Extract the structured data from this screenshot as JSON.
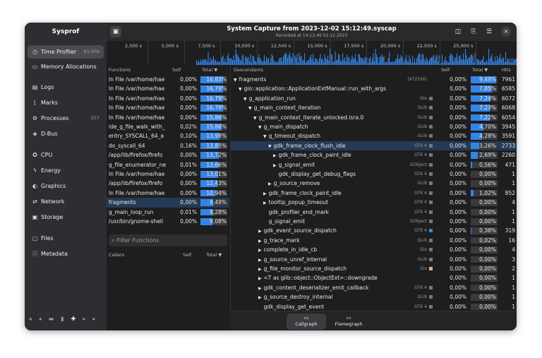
{
  "app": {
    "title": "Sysprof"
  },
  "header": {
    "title": "System Capture from 2023-12-02 15:12:49.syscap",
    "subtitle": "Recorded at 14:12:49 02.12.2023"
  },
  "sidebar": {
    "items": [
      {
        "label": "Time Profiler",
        "count": "83,908",
        "icon": "clock-icon"
      },
      {
        "label": "Memory Allocations",
        "count": "",
        "icon": "memory-icon"
      },
      {
        "label": "Logs",
        "count": "",
        "icon": "logs-icon"
      },
      {
        "label": "Marks",
        "count": "",
        "icon": "marks-icon"
      },
      {
        "label": "Processes",
        "count": "557",
        "icon": "processes-icon"
      },
      {
        "label": "D-Bus",
        "count": "",
        "icon": "dbus-icon"
      },
      {
        "label": "CPU",
        "count": "",
        "icon": "cpu-icon"
      },
      {
        "label": "Energy",
        "count": "",
        "icon": "energy-icon"
      },
      {
        "label": "Graphics",
        "count": "",
        "icon": "graphics-icon"
      },
      {
        "label": "Network",
        "count": "",
        "icon": "network-icon"
      },
      {
        "label": "Storage",
        "count": "",
        "icon": "storage-icon"
      },
      {
        "label": "Files",
        "count": "",
        "icon": "files-icon"
      },
      {
        "label": "Metadata",
        "count": "",
        "icon": "metadata-icon"
      }
    ]
  },
  "timeline": {
    "ticks": [
      "2,500 s",
      "5,000 s",
      "7,500 s",
      "10,000 s",
      "12,500 s",
      "15,000 s",
      "17,500 s",
      "20,000 s",
      "22,500 s",
      "25,000 s"
    ]
  },
  "functions": {
    "columns": {
      "name": "Functions",
      "self": "Self",
      "total": "Total"
    },
    "rows": [
      {
        "name": "In File /var/home/hae",
        "self": "0,00%",
        "total": "16,83%",
        "pct": 0.1683
      },
      {
        "name": "In File /var/home/hae",
        "self": "0,00%",
        "total": "16,79%",
        "pct": 0.1679
      },
      {
        "name": "In File /var/home/hae",
        "self": "0,00%",
        "total": "16,79%",
        "pct": 0.1679
      },
      {
        "name": "In File /var/home/hae",
        "self": "0,00%",
        "total": "16,79%",
        "pct": 0.1679
      },
      {
        "name": "In File /var/home/hae",
        "self": "0,00%",
        "total": "15,86%",
        "pct": 0.1586
      },
      {
        "name": "ide_g_file_walk_with_",
        "self": "0,02%",
        "total": "15,86%",
        "pct": 0.1586
      },
      {
        "name": "entry_SYSCALL_64_a",
        "self": "0,10%",
        "total": "13,98%",
        "pct": 0.1398
      },
      {
        "name": "do_syscall_64",
        "self": "0,16%",
        "total": "13,85%",
        "pct": 0.1385
      },
      {
        "name": "/app/lib/firefox/firefo",
        "self": "0,00%",
        "total": "13,72%",
        "pct": 0.1372
      },
      {
        "name": "g_file_enumerator_ne",
        "self": "0,01%",
        "total": "13,66%",
        "pct": 0.1366
      },
      {
        "name": "In File /var/home/hae",
        "self": "0,00%",
        "total": "13,01%",
        "pct": 0.1301
      },
      {
        "name": "/app/lib/firefox/firefo",
        "self": "0,00%",
        "total": "12,43%",
        "pct": 0.1243
      },
      {
        "name": "In File /var/home/hae",
        "self": "0,00%",
        "total": "10,94%",
        "pct": 0.1094
      },
      {
        "name": "fragments",
        "self": "0,00%",
        "total": "9,49%",
        "pct": 0.0949
      },
      {
        "name": "g_main_loop_run",
        "self": "0,01%",
        "total": "9,28%",
        "pct": 0.0928
      },
      {
        "name": "/usr/bin/gnome-shell",
        "self": "0,00%",
        "total": "9,08%",
        "pct": 0.0908
      }
    ],
    "filter_placeholder": "Filter Functions"
  },
  "callers": {
    "columns": {
      "name": "Callers",
      "self": "Self",
      "total": "Total"
    }
  },
  "descendants": {
    "columns": {
      "name": "Descendants",
      "self": "Self",
      "total": "Total",
      "hits": "Hits"
    },
    "rows": [
      {
        "name": "fragments",
        "lib": "(972526)",
        "self": "0,00%",
        "total": "9,49%",
        "hits": "7961",
        "pct": 0.0949,
        "depth": 0,
        "expander": "▼"
      },
      {
        "name": "gio::application::ApplicationExtManual::run_with_args",
        "lib": "",
        "self": "0,00%",
        "total": "7,85%",
        "hits": "6585",
        "pct": 0.0785,
        "depth": 1,
        "expander": "▼"
      },
      {
        "name": "g_application_run",
        "lib": "Gio",
        "self": "0,00%",
        "total": "7,24%",
        "hits": "6072",
        "pct": 0.0724,
        "depth": 2,
        "expander": "▼"
      },
      {
        "name": "g_main_context_iteration",
        "lib": "GLib",
        "self": "0,00%",
        "total": "7,23%",
        "hits": "6068",
        "pct": 0.0723,
        "depth": 3,
        "expander": "▼"
      },
      {
        "name": "g_main_context_iterate_unlocked.isra.0",
        "lib": "GLib",
        "self": "0,00%",
        "total": "7,22%",
        "hits": "6054",
        "pct": 0.0722,
        "depth": 4,
        "expander": "▼"
      },
      {
        "name": "g_main_dispatch",
        "lib": "GLib",
        "self": "0,00%",
        "total": "4,70%",
        "hits": "3945",
        "pct": 0.047,
        "depth": 5,
        "expander": "▼"
      },
      {
        "name": "g_timeout_dispatch",
        "lib": "GLib",
        "self": "0,00%",
        "total": "4,28%",
        "hits": "3591",
        "pct": 0.0428,
        "depth": 6,
        "expander": "▼"
      },
      {
        "name": "gdk_frame_clock_flush_idle",
        "lib": "GTK 4",
        "self": "0,00%",
        "total": "3,26%",
        "hits": "2733",
        "pct": 0.0326,
        "depth": 7,
        "expander": "▼"
      },
      {
        "name": "gdk_frame_clock_paint_idle",
        "lib": "GTK 4",
        "self": "0,00%",
        "total": "2,69%",
        "hits": "2260",
        "pct": 0.0269,
        "depth": 8,
        "expander": "▶"
      },
      {
        "name": "g_signal_emit",
        "lib": "GObject",
        "self": "0,00%",
        "total": "0,56%",
        "hits": "471",
        "pct": 0.0056,
        "depth": 8,
        "expander": "▶"
      },
      {
        "name": "gdk_display_get_debug_flags",
        "lib": "GTK 4",
        "self": "0,00%",
        "total": "0,00%",
        "hits": "1",
        "pct": 0,
        "depth": 8,
        "expander": ""
      },
      {
        "name": "g_source_remove",
        "lib": "GLib",
        "self": "0,00%",
        "total": "0,00%",
        "hits": "1",
        "pct": 0,
        "depth": 7,
        "expander": "▶"
      },
      {
        "name": "gdk_frame_clock_paint_idle",
        "lib": "GTK 4",
        "self": "0,00%",
        "total": "1,02%",
        "hits": "852",
        "pct": 0.0102,
        "depth": 6,
        "expander": "▶"
      },
      {
        "name": "tooltip_popup_timeout",
        "lib": "GTK 4",
        "self": "0,00%",
        "total": "0,00%",
        "hits": "4",
        "pct": 0,
        "depth": 6,
        "expander": "▶"
      },
      {
        "name": "gdk_profiler_end_mark",
        "lib": "GTK 4",
        "self": "0,00%",
        "total": "0,00%",
        "hits": "1",
        "pct": 0,
        "depth": 6,
        "expander": ""
      },
      {
        "name": "g_signal_emit",
        "lib": "GObject",
        "self": "0,00%",
        "total": "0,00%",
        "hits": "1",
        "pct": 0,
        "depth": 6,
        "expander": ""
      },
      {
        "name": "gdk_event_source_dispatch",
        "lib": "GTK 4",
        "self": "0,00%",
        "total": "0,38%",
        "hits": "319",
        "pct": 0.0038,
        "depth": 5,
        "expander": "▶"
      },
      {
        "name": "g_trace_mark",
        "lib": "GLib",
        "self": "0,00%",
        "total": "0,02%",
        "hits": "16",
        "pct": 0.0002,
        "depth": 5,
        "expander": "▶"
      },
      {
        "name": "complete_in_idle_cb",
        "lib": "Gio",
        "self": "0,00%",
        "total": "0,00%",
        "hits": "4",
        "pct": 0,
        "depth": 5,
        "expander": "▶"
      },
      {
        "name": "g_source_unref_internal",
        "lib": "GLib",
        "self": "0,00%",
        "total": "0,00%",
        "hits": "3",
        "pct": 0,
        "depth": 5,
        "expander": "▶"
      },
      {
        "name": "g_file_monitor_source_dispatch",
        "lib": "Gio",
        "self": "0,00%",
        "total": "0,00%",
        "hits": "2",
        "pct": 0,
        "depth": 5,
        "expander": "▶"
      },
      {
        "name": "<T as glib::object::ObjectExt>::downgrade",
        "lib": "",
        "self": "0,00%",
        "total": "0,00%",
        "hits": "1",
        "pct": 0,
        "depth": 5,
        "expander": "▶"
      },
      {
        "name": "gdk_content_deserializer_emit_callback",
        "lib": "GTK 4",
        "self": "0,00%",
        "total": "0,00%",
        "hits": "1",
        "pct": 0,
        "depth": 5,
        "expander": "▶"
      },
      {
        "name": "g_source_destroy_internal",
        "lib": "GLib",
        "self": "0,00%",
        "total": "0,00%",
        "hits": "1",
        "pct": 0,
        "depth": 5,
        "expander": "▶"
      },
      {
        "name": "gdk_display_get_event",
        "lib": "GTK 4",
        "self": "0,00%",
        "total": "0,00%",
        "hits": "1",
        "pct": 0,
        "depth": 5,
        "expander": ""
      }
    ]
  },
  "tabs": [
    {
      "label": "Callgraph",
      "icon": "callgraph-icon",
      "selected": true
    },
    {
      "label": "Flamegraph",
      "icon": "flamegraph-icon",
      "selected": false
    }
  ],
  "colors": {
    "accent": "#3584e4",
    "selection": "#243a55"
  }
}
